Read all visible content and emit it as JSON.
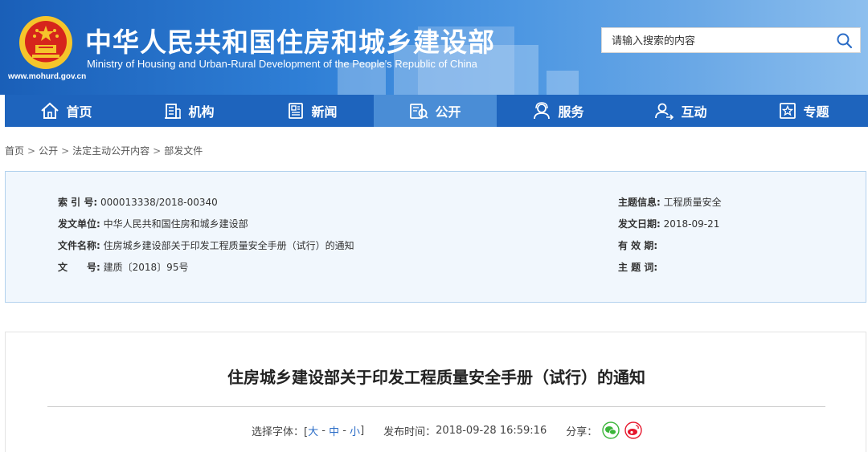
{
  "header": {
    "title_cn": "中华人民共和国住房和城乡建设部",
    "title_en": "Ministry of Housing and Urban-Rural Development of the People's Republic of China",
    "url": "www.mohurd.gov.cn",
    "search_placeholder": "请输入搜索的内容"
  },
  "nav": {
    "items": [
      {
        "label": "首页",
        "icon": "home-icon"
      },
      {
        "label": "机构",
        "icon": "building-icon"
      },
      {
        "label": "新闻",
        "icon": "news-icon"
      },
      {
        "label": "公开",
        "icon": "disclosure-icon"
      },
      {
        "label": "服务",
        "icon": "service-icon"
      },
      {
        "label": "互动",
        "icon": "interaction-icon"
      },
      {
        "label": "专题",
        "icon": "topic-icon"
      }
    ],
    "active": "公开"
  },
  "breadcrumb": [
    "首页",
    "公开",
    "法定主动公开内容",
    "部发文件"
  ],
  "info": {
    "left": [
      {
        "key": "索 引 号:",
        "value": "000013338/2018-00340"
      },
      {
        "key": "发文单位:",
        "value": "中华人民共和国住房和城乡建设部"
      },
      {
        "key": "文件名称:",
        "value": "住房城乡建设部关于印发工程质量安全手册（试行）的通知"
      },
      {
        "key": "文　　号:",
        "value": "建质〔2018〕95号"
      }
    ],
    "right": [
      {
        "key": "主题信息:",
        "value": "工程质量安全"
      },
      {
        "key": "发文日期:",
        "value": "2018-09-21"
      },
      {
        "key": "有 效 期:",
        "value": ""
      },
      {
        "key": "主 题 词:",
        "value": ""
      }
    ]
  },
  "article": {
    "title": "住房城乡建设部关于印发工程质量安全手册（试行）的通知",
    "font_label": "选择字体：[",
    "font_large": "大",
    "font_medium": "中",
    "font_small": "小",
    "font_close": "]",
    "publish_label": "发布时间：",
    "publish_time": "2018-09-28 16:59:16",
    "share_label": "分享："
  },
  "colors": {
    "nav_bg": "#1e64bd",
    "nav_active": "#4a8dd6",
    "info_bg": "#f1f7fd",
    "wechat": "#3bb53a",
    "weibo": "#e6162d"
  }
}
